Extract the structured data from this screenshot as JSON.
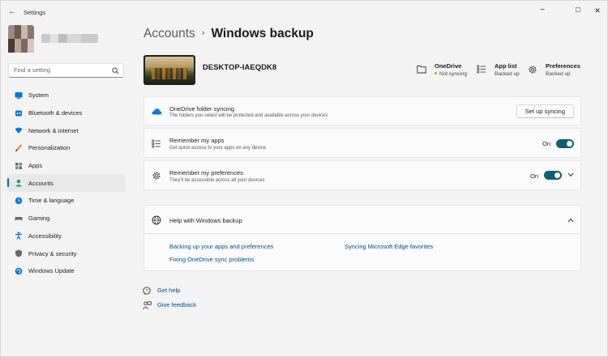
{
  "window": {
    "title": "Settings",
    "back_glyph": "←",
    "minimize_glyph": "−",
    "maximize_glyph": "□",
    "close_glyph": "✕"
  },
  "search": {
    "placeholder": "Find a setting"
  },
  "sidebar": {
    "items": [
      {
        "label": "System",
        "icon": "system-icon",
        "color": "#0078d4"
      },
      {
        "label": "Bluetooth & devices",
        "icon": "bluetooth-icon",
        "color": "#0078d4"
      },
      {
        "label": "Network & internet",
        "icon": "wifi-icon",
        "color": "#0078d4"
      },
      {
        "label": "Personalization",
        "icon": "brush-icon",
        "color": "#d47500"
      },
      {
        "label": "Apps",
        "icon": "apps-icon",
        "color": "#5d6b7a"
      },
      {
        "label": "Accounts",
        "icon": "person-icon",
        "color": "#2a9d5c",
        "active": true
      },
      {
        "label": "Time & language",
        "icon": "globe-clock-icon",
        "color": "#0078d4"
      },
      {
        "label": "Gaming",
        "icon": "controller-icon",
        "color": "#6b6b6b"
      },
      {
        "label": "Accessibility",
        "icon": "accessibility-icon",
        "color": "#0078d4"
      },
      {
        "label": "Privacy & security",
        "icon": "shield-icon",
        "color": "#6b6b6b"
      },
      {
        "label": "Windows Update",
        "icon": "update-icon",
        "color": "#0078d4"
      }
    ]
  },
  "breadcrumb": {
    "parent": "Accounts",
    "separator": "›",
    "current": "Windows backup"
  },
  "device": {
    "name": "DESKTOP-IAEQDK8"
  },
  "status": {
    "onedrive": {
      "title": "OneDrive",
      "subtitle": "Not syncing",
      "dot_color": "#c59f00"
    },
    "applist": {
      "title": "App list",
      "subtitle": "Backed up"
    },
    "preferences": {
      "title": "Preferences",
      "subtitle": "Backed up"
    }
  },
  "cards": {
    "onedrive": {
      "title": "OneDrive folder syncing",
      "subtitle": "The folders you select will be protected and available across your devices",
      "button": "Set up syncing"
    },
    "apps": {
      "title": "Remember my apps",
      "subtitle": "Get quick access to your apps on any device",
      "toggle_label": "On"
    },
    "prefs": {
      "title": "Remember my preferences",
      "subtitle": "They'll be accessible across all your devices",
      "toggle_label": "On"
    }
  },
  "help": {
    "title": "Help with Windows backup",
    "links": [
      "Backing up your apps and preferences",
      "Syncing Microsoft Edge favorites",
      "Fixing OneDrive sync problems"
    ]
  },
  "footer": {
    "get_help": "Get help",
    "give_feedback": "Give feedback"
  },
  "colors": {
    "accent": "#0067c0",
    "toggle_on": "#0f5f73",
    "link": "#004e8c"
  }
}
